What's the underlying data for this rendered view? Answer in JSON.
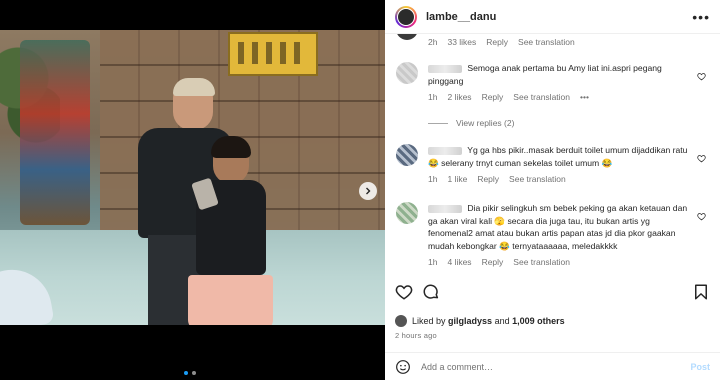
{
  "post": {
    "username": "lambe__danu",
    "more_label": "•••"
  },
  "comments_section": {
    "top_meta": {
      "time": "2h",
      "likes": "33 likes",
      "reply": "Reply",
      "translate": "See translation"
    },
    "comments": [
      {
        "text": "Semoga anak pertama bu Amy liat ini.aspri pegang pinggang",
        "time": "1h",
        "likes": "2 likes",
        "reply": "Reply",
        "translate": "See translation",
        "more": "•••",
        "view_replies": "View replies (2)"
      },
      {
        "text": "Yg ga hbs pikir..masak berduit toilet umum dijaddikan ratu 😂 selerany trnyt cuman sekelas toilet umum 😂",
        "time": "1h",
        "likes": "1 like",
        "reply": "Reply",
        "translate": "See translation"
      },
      {
        "text": "Dia pikir selingkuh sm bebek peking ga akan ketauan dan ga akan viral kali 🫣 secara dia juga tau, itu bukan artis yg fenomenal2 amat atau bukan artis papan atas jd dia pkor gaakan mudah kebongkar 😂 ternyataaaaaa, meledakkkk",
        "time": "1h",
        "likes": "4 likes",
        "reply": "Reply",
        "translate": "See translation"
      }
    ]
  },
  "footer": {
    "liked_prefix": "Liked by",
    "liked_user": "gilgladyss",
    "liked_and": "and",
    "liked_others": "1,009 others",
    "time_ago": "2 hours ago",
    "comment_placeholder": "Add a comment…",
    "post_label": "Post"
  },
  "carousel": {
    "slides": 2,
    "active_slide": 1
  }
}
